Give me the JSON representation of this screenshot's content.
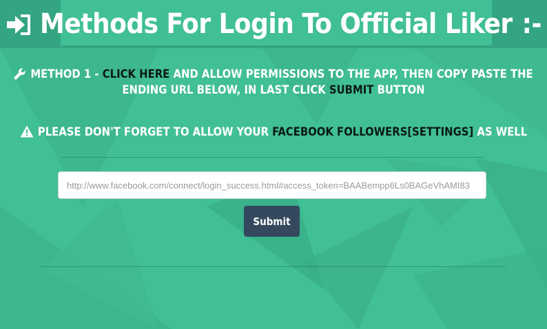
{
  "header": {
    "title": "Methods For Login To Official Liker",
    "title_suffix": ":-",
    "icon": "sign-in-icon"
  },
  "method": {
    "icon": "wrench-icon",
    "prefix": "METHOD 1 - ",
    "link_text": "CLICK HERE",
    "middle": " AND ALLOW PERMISSIONS TO THE APP, THEN COPY PASTE THE ENDING URL BELOW, IN LAST CLICK ",
    "submit_word": "SUBMIT",
    "suffix": " BUTTON"
  },
  "warning": {
    "icon": "warning-icon",
    "prefix": "PLEASE DON'T FORGET TO ALLOW YOUR ",
    "highlight": "FACEBOOK FOLLOWERS[SETTINGS]",
    "suffix": " AS WELL"
  },
  "form": {
    "placeholder": "http://www.facebook.com/connect/login_success.html#access_token=BAABempp6Ls0BAGeVhAMI83",
    "submit_label": "Submit"
  },
  "colors": {
    "background": "#41bf95",
    "header_band": "#34a582",
    "button": "#34495e",
    "highlight_text": "#0b1a14"
  }
}
